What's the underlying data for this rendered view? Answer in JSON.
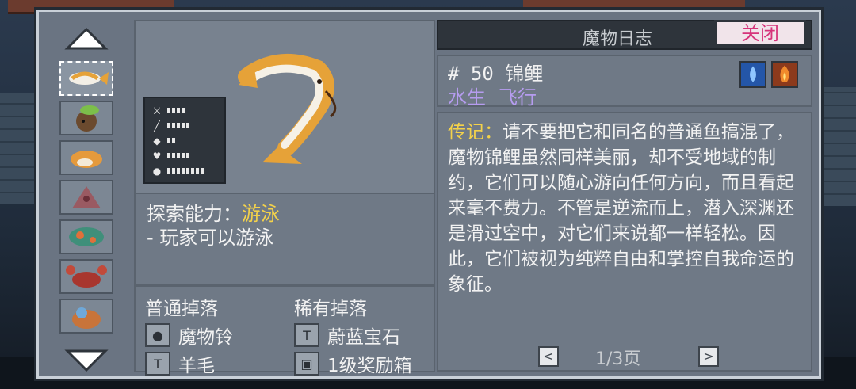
{
  "header": {
    "title": "魔物日志",
    "close_label": "关闭"
  },
  "sidebar": {
    "entries": [
      {
        "name": "koi",
        "selected": true
      },
      {
        "name": "bear"
      },
      {
        "name": "fox"
      },
      {
        "name": "bat"
      },
      {
        "name": "plant"
      },
      {
        "name": "crab"
      },
      {
        "name": "otter"
      }
    ]
  },
  "monster": {
    "number": "# 50",
    "name": "锦鲤",
    "types": [
      "水生",
      "飞行"
    ],
    "elements": [
      "water-icon",
      "fire-icon"
    ]
  },
  "stats": [
    {
      "icon": "sword-icon",
      "level": 4
    },
    {
      "icon": "staff-icon",
      "level": 5
    },
    {
      "icon": "shield-icon",
      "level": 2
    },
    {
      "icon": "defense-icon",
      "level": 5
    },
    {
      "icon": "speed-icon",
      "level": 8
    }
  ],
  "ability": {
    "label": "探索能力：",
    "value": "游泳",
    "desc": "- 玩家可以游泳"
  },
  "drops": {
    "common_title": "普通掉落",
    "rare_title": "稀有掉落",
    "common": [
      {
        "label": "魔物铃",
        "icon": "bell-icon"
      },
      {
        "label": "羊毛",
        "icon": "wool-icon"
      }
    ],
    "rare": [
      {
        "label": "蔚蓝宝石",
        "icon": "gem-icon"
      },
      {
        "label": "1级奖励箱",
        "icon": "chest-icon"
      }
    ]
  },
  "lore": {
    "label": "传记：",
    "text": "请不要把它和同名的普通鱼搞混了，魔物锦鲤虽然同样美丽，却不受地域的制约，它们可以随心游向任何方向，而且看起来毫不费力。不管是逆流而上，潜入深渊还是滑过空中，对它们来说都一样轻松。因此，它们被视为纯粹自由和掌控自我命运的象征。"
  },
  "pager": {
    "text": "1/3页",
    "prev": "<",
    "next": ">"
  },
  "colors": {
    "accent_yellow": "#f4d24a",
    "type_purple": "#b69cf0",
    "close_pink": "#d6337a"
  }
}
